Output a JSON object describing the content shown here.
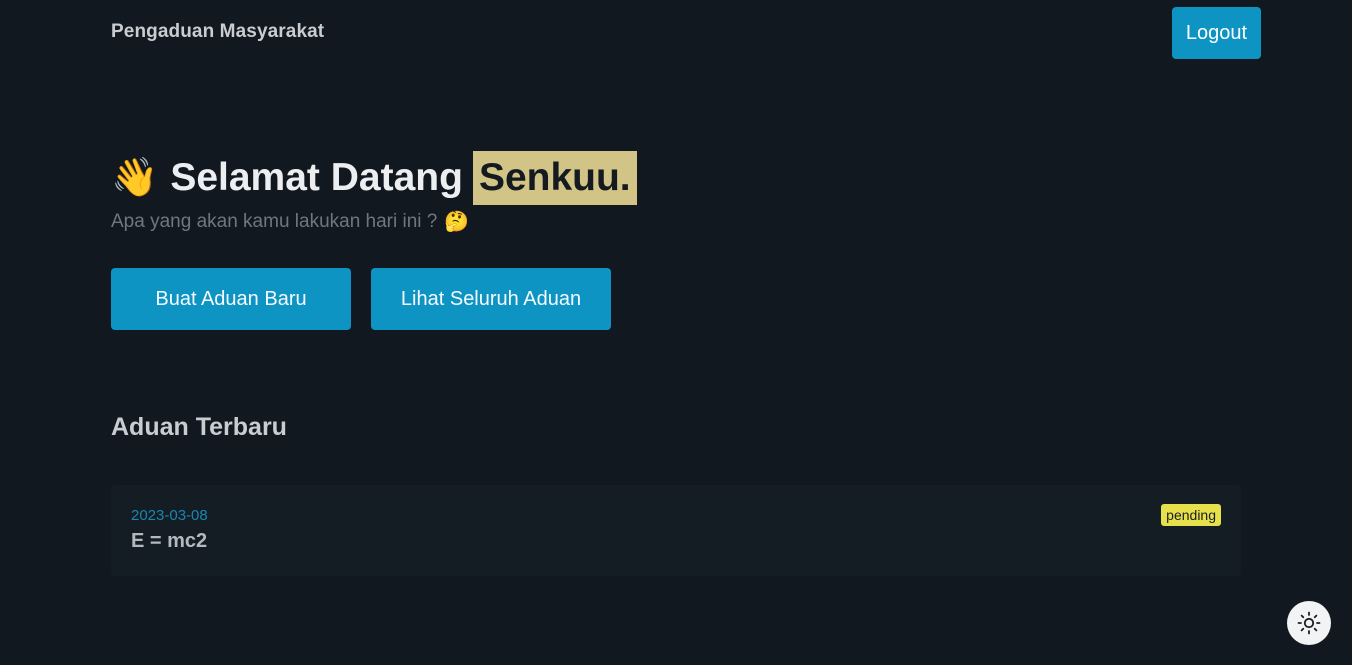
{
  "navbar": {
    "brand": "Pengaduan Masyarakat",
    "logout_label": "Logout"
  },
  "hero": {
    "greeting_icon": "waving-hand-emoji",
    "greeting_emoji": "👋",
    "greeting": "Selamat Datang",
    "username": "Senkuu.",
    "subtitle": "Apa yang akan kamu lakukan hari ini ?",
    "subtitle_icon": "thinking-face-emoji",
    "subtitle_emoji": "🤔"
  },
  "actions": {
    "create_label": "Buat Aduan Baru",
    "view_all_label": "Lihat Seluruh Aduan"
  },
  "latest": {
    "title": "Aduan Terbaru",
    "items": [
      {
        "date": "2023-03-08",
        "title": "E = mc2",
        "status": "pending"
      }
    ]
  },
  "theme_toggle": {
    "icon": "sun-icon"
  },
  "colors": {
    "background": "#11181f",
    "accent": "#0e94c2",
    "highlight": "#d2c486",
    "status_pending": "#e6e04a",
    "card": "#141c24"
  }
}
